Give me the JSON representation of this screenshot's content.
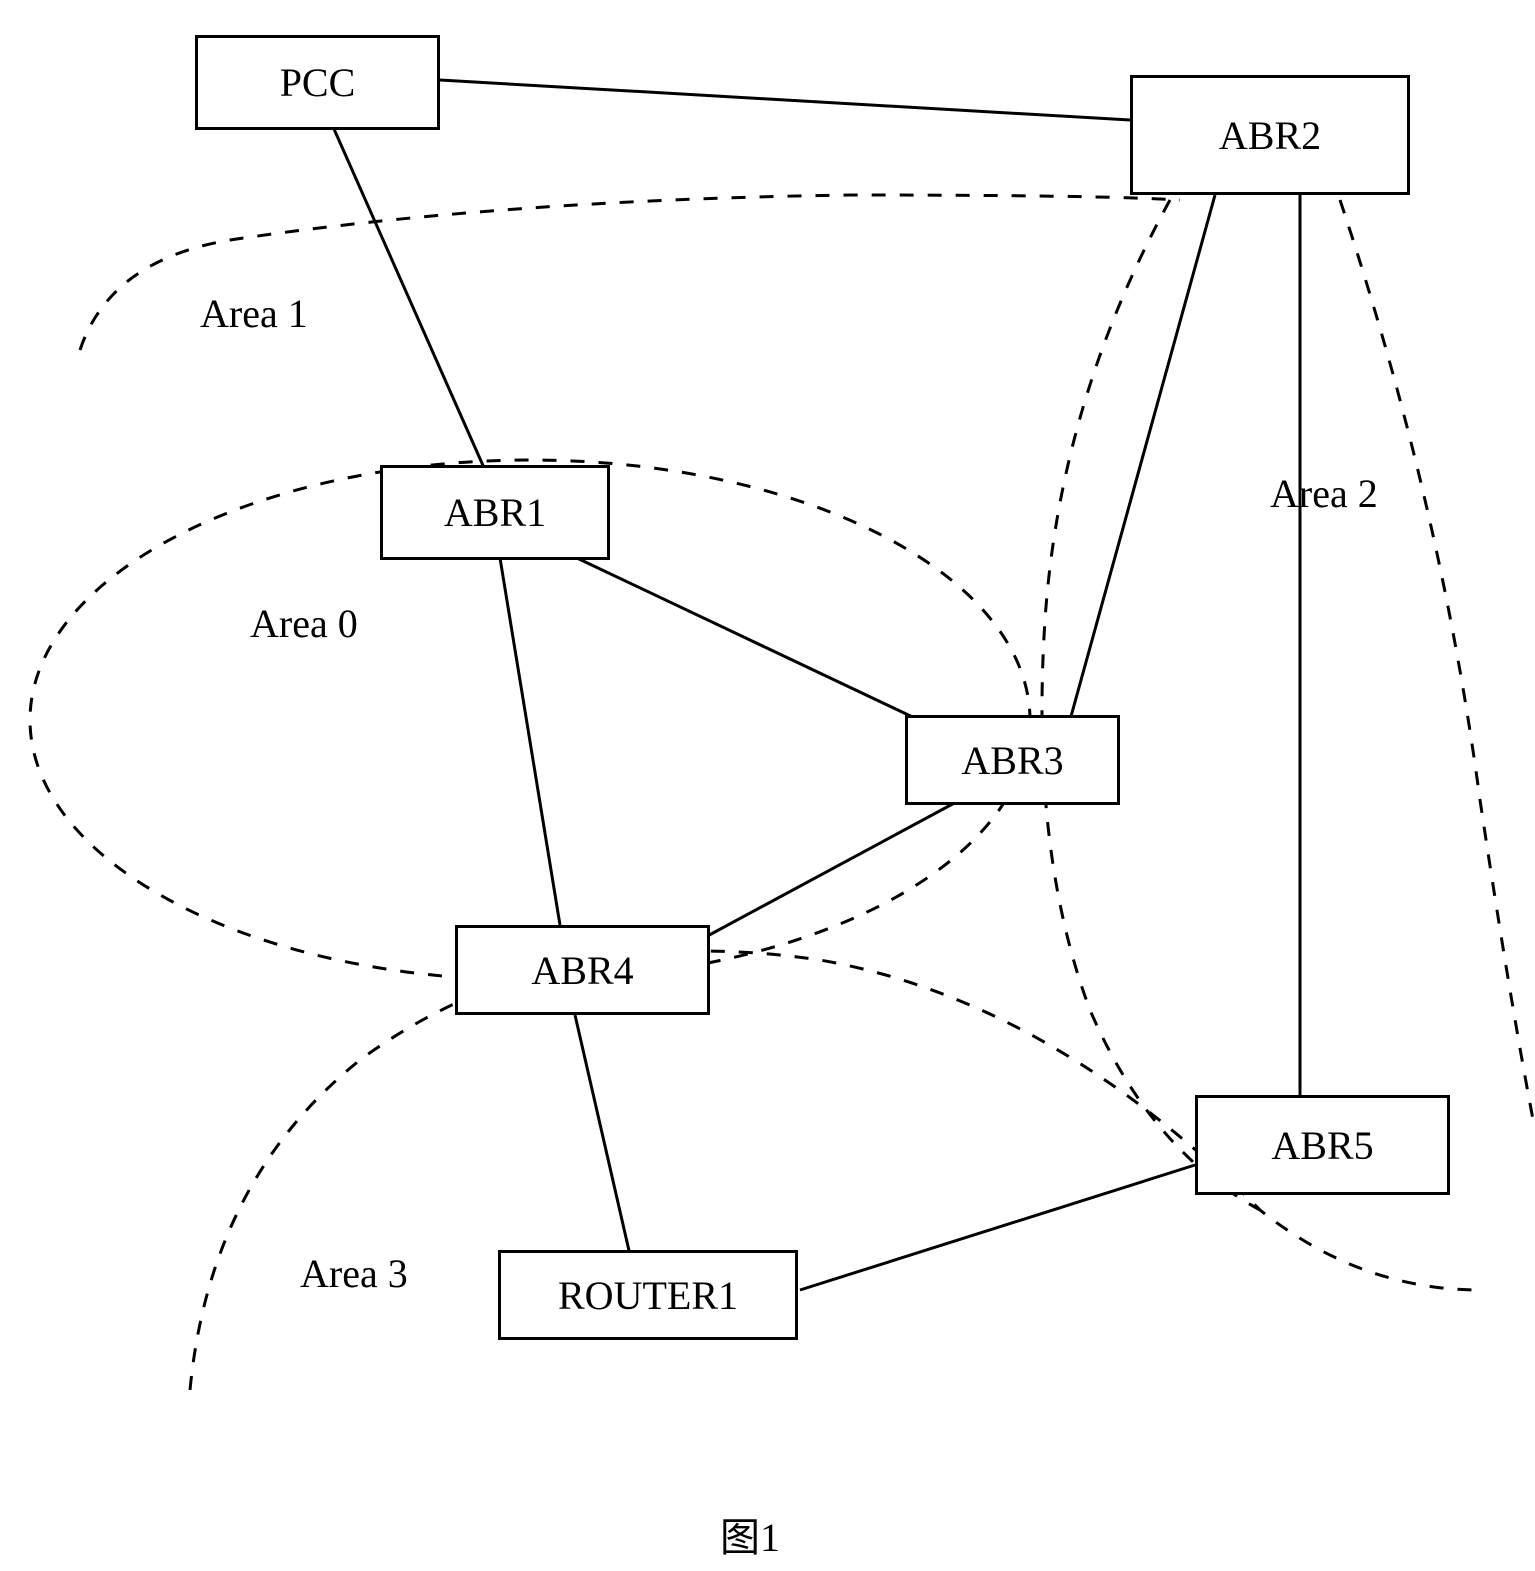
{
  "nodes": {
    "pcc": "PCC",
    "abr1": "ABR1",
    "abr2": "ABR2",
    "abr3": "ABR3",
    "abr4": "ABR4",
    "abr5": "ABR5",
    "router1": "ROUTER1"
  },
  "areas": {
    "area0": "Area 0",
    "area1": "Area 1",
    "area2": "Area 2",
    "area3": "Area 3"
  },
  "caption": "图1",
  "chart_data": {
    "type": "diagram",
    "title": "图1",
    "nodes": [
      {
        "id": "PCC",
        "type": "node"
      },
      {
        "id": "ABR1",
        "type": "area-border-router"
      },
      {
        "id": "ABR2",
        "type": "area-border-router"
      },
      {
        "id": "ABR3",
        "type": "area-border-router"
      },
      {
        "id": "ABR4",
        "type": "area-border-router"
      },
      {
        "id": "ABR5",
        "type": "area-border-router"
      },
      {
        "id": "ROUTER1",
        "type": "router"
      }
    ],
    "edges": [
      {
        "from": "PCC",
        "to": "ABR2"
      },
      {
        "from": "PCC",
        "to": "ABR1"
      },
      {
        "from": "ABR1",
        "to": "ABR3"
      },
      {
        "from": "ABR1",
        "to": "ABR4"
      },
      {
        "from": "ABR3",
        "to": "ABR4"
      },
      {
        "from": "ABR2",
        "to": "ABR3"
      },
      {
        "from": "ABR2",
        "to": "ABR5"
      },
      {
        "from": "ABR4",
        "to": "ROUTER1"
      },
      {
        "from": "ROUTER1",
        "to": "ABR5"
      }
    ],
    "areas": [
      {
        "name": "Area 0",
        "members": [
          "ABR1",
          "ABR3",
          "ABR4"
        ]
      },
      {
        "name": "Area 1",
        "members": [
          "PCC",
          "ABR1",
          "ABR2"
        ]
      },
      {
        "name": "Area 2",
        "members": [
          "ABR2",
          "ABR3",
          "ABR5"
        ]
      },
      {
        "name": "Area 3",
        "members": [
          "ABR4",
          "ABR5",
          "ROUTER1"
        ]
      }
    ]
  }
}
